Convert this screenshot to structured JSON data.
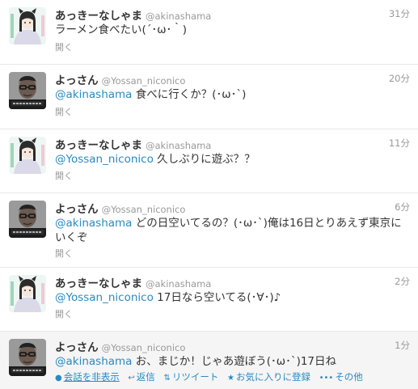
{
  "tweets": [
    {
      "name": "あっきーなしゃま",
      "handle": "@akinashama",
      "time": "31分",
      "mention": "",
      "text": "ラーメン食べたい(´･ω･｀)",
      "open": "開く"
    },
    {
      "name": "よっさん",
      "handle": "@Yossan_niconico",
      "time": "20分",
      "mention": "@akinashama",
      "text": " 食べに行くか？(･ω･`)",
      "open": "開く"
    },
    {
      "name": "あっきーなしゃま",
      "handle": "@akinashama",
      "time": "11分",
      "mention": "@Yossan_niconico",
      "text": " 久しぶりに遊ぶ？？",
      "open": "開く"
    },
    {
      "name": "よっさん",
      "handle": "@Yossan_niconico",
      "time": "6分",
      "mention": "@akinashama",
      "text": " どの日空いてるの？(･ω･`)俺は16日とりあえず東京にいくぞ",
      "open": "開く"
    },
    {
      "name": "あっきーなしゃま",
      "handle": "@akinashama",
      "time": "2分",
      "mention": "@Yossan_niconico",
      "text": " 17日なら空いてる(･∀･)♪",
      "open": "開く"
    },
    {
      "name": "よっさん",
      "handle": "@Yossan_niconico",
      "time": "1分",
      "mention": "@akinashama",
      "text": " お、まじか！じゃあ遊ぼう(･ω･`)17日ね",
      "actions": {
        "conversation": "会話を非表示",
        "reply": "返信",
        "retweet": "リツイート",
        "favorite": "お気に入りに登録",
        "more": "その他"
      }
    }
  ],
  "colors": {
    "link": "#2a8ac3",
    "meta": "#999999",
    "text": "#333333",
    "hover_bg": "#f5f5f5"
  },
  "icons": {
    "conversation": "conversation-icon",
    "reply": "reply-icon",
    "retweet": "retweet-icon",
    "favorite": "star-icon",
    "more": "more-dots-icon"
  }
}
